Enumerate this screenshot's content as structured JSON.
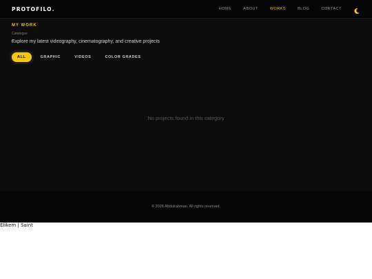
{
  "header": {
    "brand": "PROTOFILO.",
    "nav": [
      {
        "label": "HOME",
        "active": false
      },
      {
        "label": "ABOUT",
        "active": false
      },
      {
        "label": "WORKS",
        "active": true
      },
      {
        "label": "BLOG",
        "active": false
      },
      {
        "label": "CONTACT",
        "active": false
      }
    ],
    "theme_toggle_icon": "moon-icon"
  },
  "works": {
    "title": "MY WORK",
    "subtitle": "Catalogue",
    "description": "Explore my latest videography, cinematography, and creative projects",
    "filters": [
      {
        "label": "ALL",
        "active": true
      },
      {
        "label": "GRAPHIC",
        "active": false
      },
      {
        "label": "VIDEOS",
        "active": false
      },
      {
        "label": "COLOR GRADES",
        "active": false
      }
    ],
    "empty_message": "No projects found in this category"
  },
  "footer": {
    "copyright": "© 2026 Abdulrahman. All rights reserved."
  },
  "below_page_text": "Elikem | Saint",
  "colors": {
    "accent": "#f5c518",
    "background": "#0d0d0d",
    "nav_background": "#050505"
  }
}
